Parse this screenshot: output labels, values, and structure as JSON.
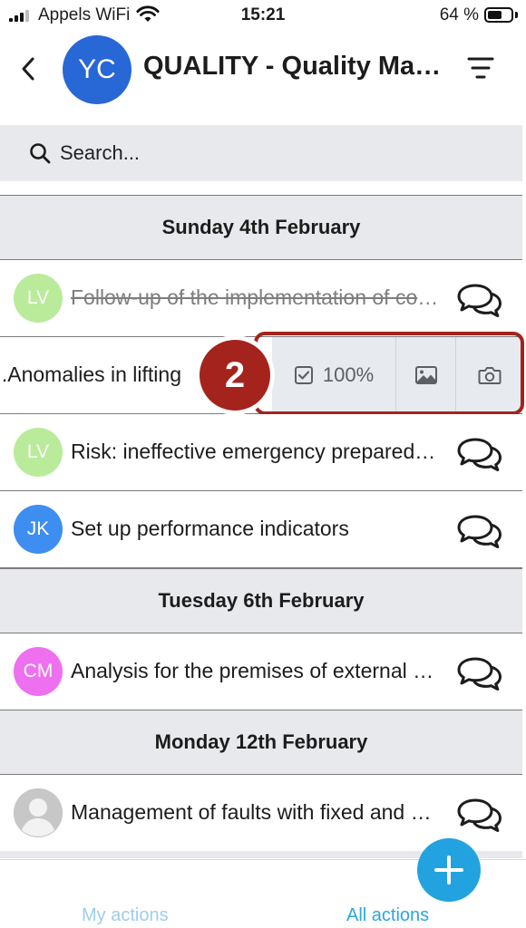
{
  "status_bar": {
    "carrier": "Appels WiFi",
    "time": "15:21",
    "battery": "64 %",
    "battery_level": 0.64
  },
  "header": {
    "avatar_initials": "YC",
    "title": "QUALITY - Quality Management",
    "avatar_color": "#2867d6"
  },
  "search": {
    "placeholder": "Search..."
  },
  "sections": [
    {
      "date": "Sunday 4th February",
      "items": [
        {
          "initials": "LV",
          "color": "#b9eb9b",
          "title": "Follow-up of the implementation of corrective actions",
          "completed": true
        },
        {
          "title": "Anomalies in lifting...",
          "swiped": true,
          "progress": "100%",
          "step": "2"
        },
        {
          "initials": "LV",
          "color": "#b9eb9b",
          "title": "Risk: ineffective emergency preparedness"
        },
        {
          "initials": "JK",
          "color": "#3d8ef0",
          "title": "Set up performance indicators"
        }
      ]
    },
    {
      "date": "Tuesday 6th February",
      "items": [
        {
          "initials": "CM",
          "color": "#ee6ff0",
          "title": "Analysis for the premises of external service providers"
        }
      ]
    },
    {
      "date": "Monday 12th February",
      "items": [
        {
          "initials": "",
          "color": "#c7c7c7",
          "title": "Management of faults with fixed and mobile equipment"
        }
      ]
    }
  ],
  "tabs": {
    "my_actions": "My actions",
    "all_actions": "All actions"
  },
  "colors": {
    "accent": "#22a3df",
    "highlight": "#a5231d",
    "section_bg": "#e7e9ec"
  }
}
